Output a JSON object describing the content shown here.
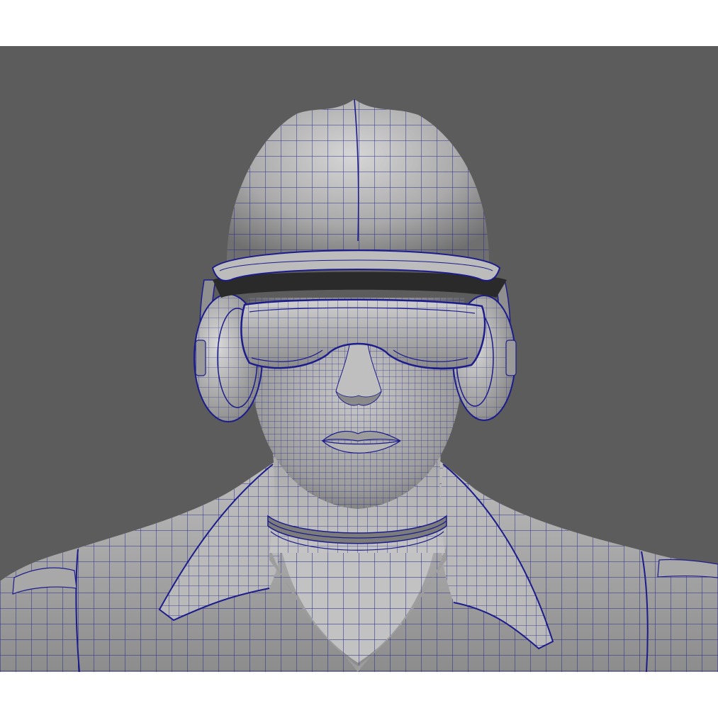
{
  "viewport": {
    "background_color": "#5c5c5c",
    "surface_color": "#b4b4b4",
    "surface_shadow_color": "#6e6e6e",
    "wireframe_color": "#1c1c8c",
    "subject": "wireframe-bust"
  },
  "image_border": {
    "color": "#ffffff"
  }
}
